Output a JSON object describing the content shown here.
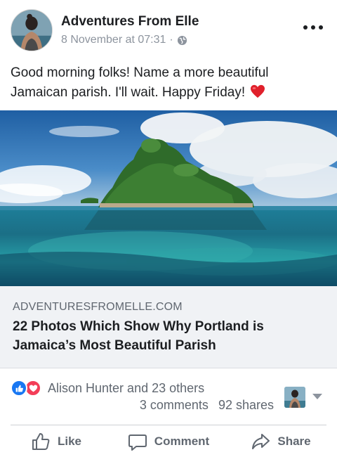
{
  "post": {
    "author": "Adventures From Elle",
    "timestamp": "8 November at 07:31",
    "separator": "·",
    "privacy_icon": "globe-icon",
    "text": "Good morning folks! Name a more beautiful Jamaican parish. I'll wait. Happy Friday!",
    "text_emoji": "red-heart"
  },
  "link": {
    "domain": "ADVENTURESFROMELLE.COM",
    "title": "22 Photos Which Show Why Portland is Jamaica’s Most Beautiful Parish"
  },
  "engagement": {
    "reaction_icons": [
      "like-reaction-icon",
      "love-reaction-icon"
    ],
    "reactors": "Alison Hunter and 23 others",
    "comments": "3 comments",
    "shares": "92 shares"
  },
  "actions": {
    "like": "Like",
    "comment": "Comment",
    "share": "Share"
  },
  "colors": {
    "like_blue": "#1877f2",
    "love_red": "#f33e58",
    "link_bg": "#f0f2f5",
    "muted_text": "#606770"
  }
}
